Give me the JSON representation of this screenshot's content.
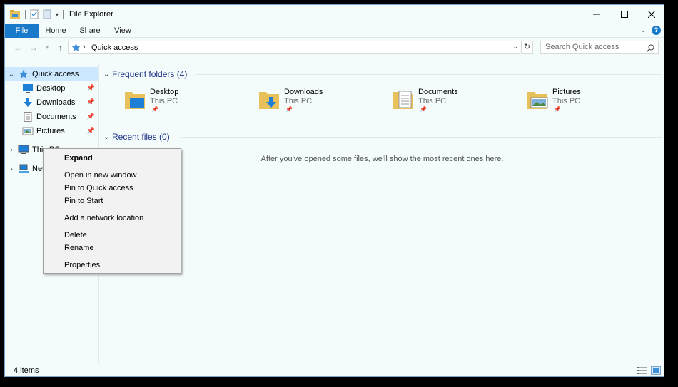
{
  "window": {
    "title": "File Explorer"
  },
  "ribbon": {
    "tabs": [
      "File",
      "Home",
      "Share",
      "View"
    ]
  },
  "address": {
    "crumb": "Quick access"
  },
  "search": {
    "placeholder": "Search Quick access"
  },
  "navpane": {
    "items": [
      {
        "label": "Quick access"
      },
      {
        "label": "Desktop"
      },
      {
        "label": "Downloads"
      },
      {
        "label": "Documents"
      },
      {
        "label": "Pictures"
      },
      {
        "label": "This PC"
      },
      {
        "label": "Network"
      }
    ]
  },
  "main": {
    "frequent_header": "Frequent folders (4)",
    "recent_header": "Recent files (0)",
    "empty_message": "After you've opened some files, we'll show the most recent ones here.",
    "folders": [
      {
        "name": "Desktop",
        "location": "This PC"
      },
      {
        "name": "Downloads",
        "location": "This PC"
      },
      {
        "name": "Documents",
        "location": "This PC"
      },
      {
        "name": "Pictures",
        "location": "This PC"
      }
    ]
  },
  "context_menu": {
    "items": [
      "Expand",
      "Open in new window",
      "Pin to Quick access",
      "Pin to Start",
      "Add a network location",
      "Delete",
      "Rename",
      "Properties"
    ]
  },
  "status": {
    "count": "4 items"
  },
  "colors": {
    "accent": "#1979ca",
    "selection": "#cce8ff",
    "header_text": "#1e3287"
  }
}
